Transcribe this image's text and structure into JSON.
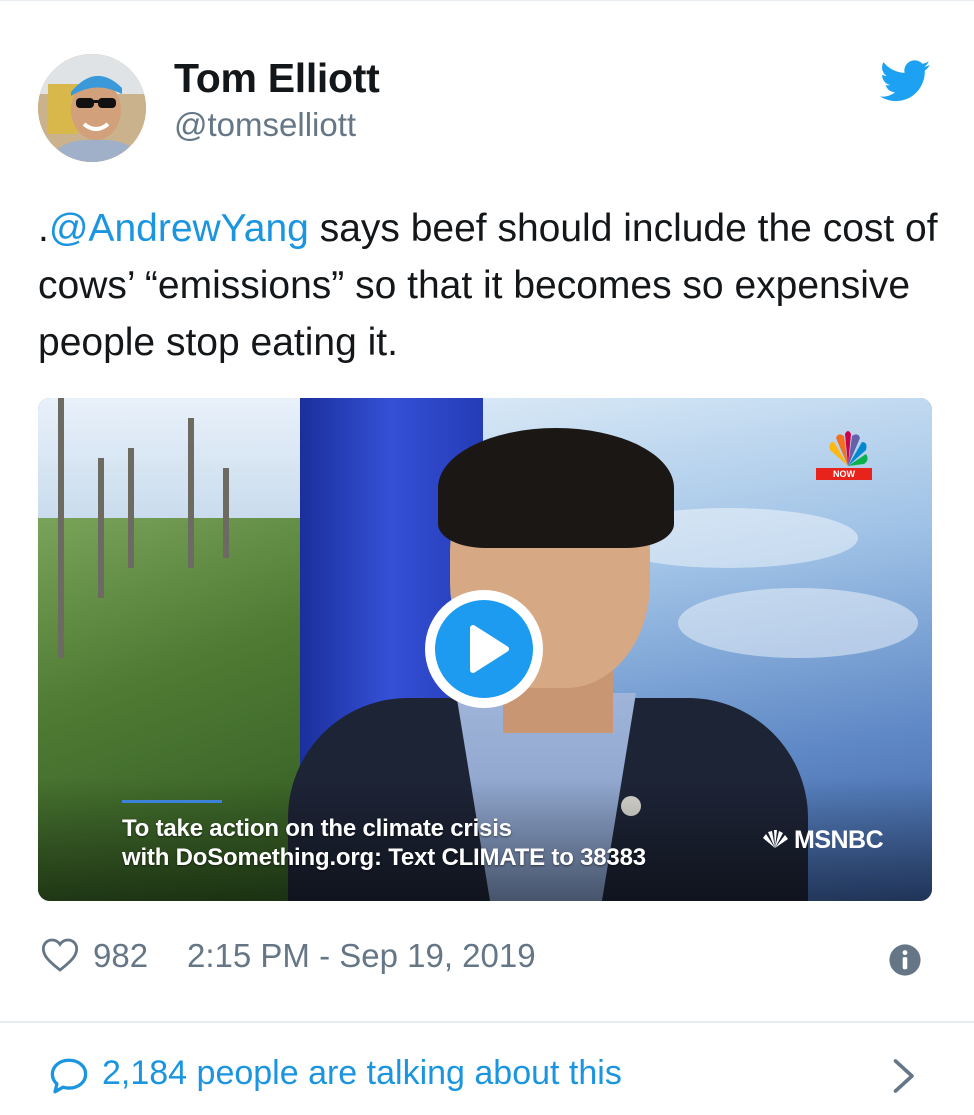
{
  "tweet": {
    "display_name": "Tom Elliott",
    "handle": "@tomselliott",
    "text_prefix": ".",
    "mention": "@AndrewYang",
    "text_body": " says beef should include the cost of cows’ “emissions” so that it becomes so expensive people stop eating it.",
    "like_count": "982",
    "timestamp": "2:15 PM - Sep 19, 2019",
    "talking": "2,184 people are talking about this"
  },
  "media": {
    "caption_line1": "To take action on the climate crisis",
    "caption_line2": "with DoSomething.org: Text CLIMATE to 38383",
    "network": "MSNBC",
    "corner_tag": "NOW"
  },
  "icons": {
    "brand": "twitter-bird-icon",
    "like": "heart-icon",
    "info": "info-icon",
    "conversation": "speech-bubble-icon",
    "more": "chevron-right-icon",
    "play": "play-icon"
  },
  "colors": {
    "link": "#1b95e0",
    "text": "#14171a",
    "secondary": "#657786",
    "divider": "#e6ecf0"
  }
}
